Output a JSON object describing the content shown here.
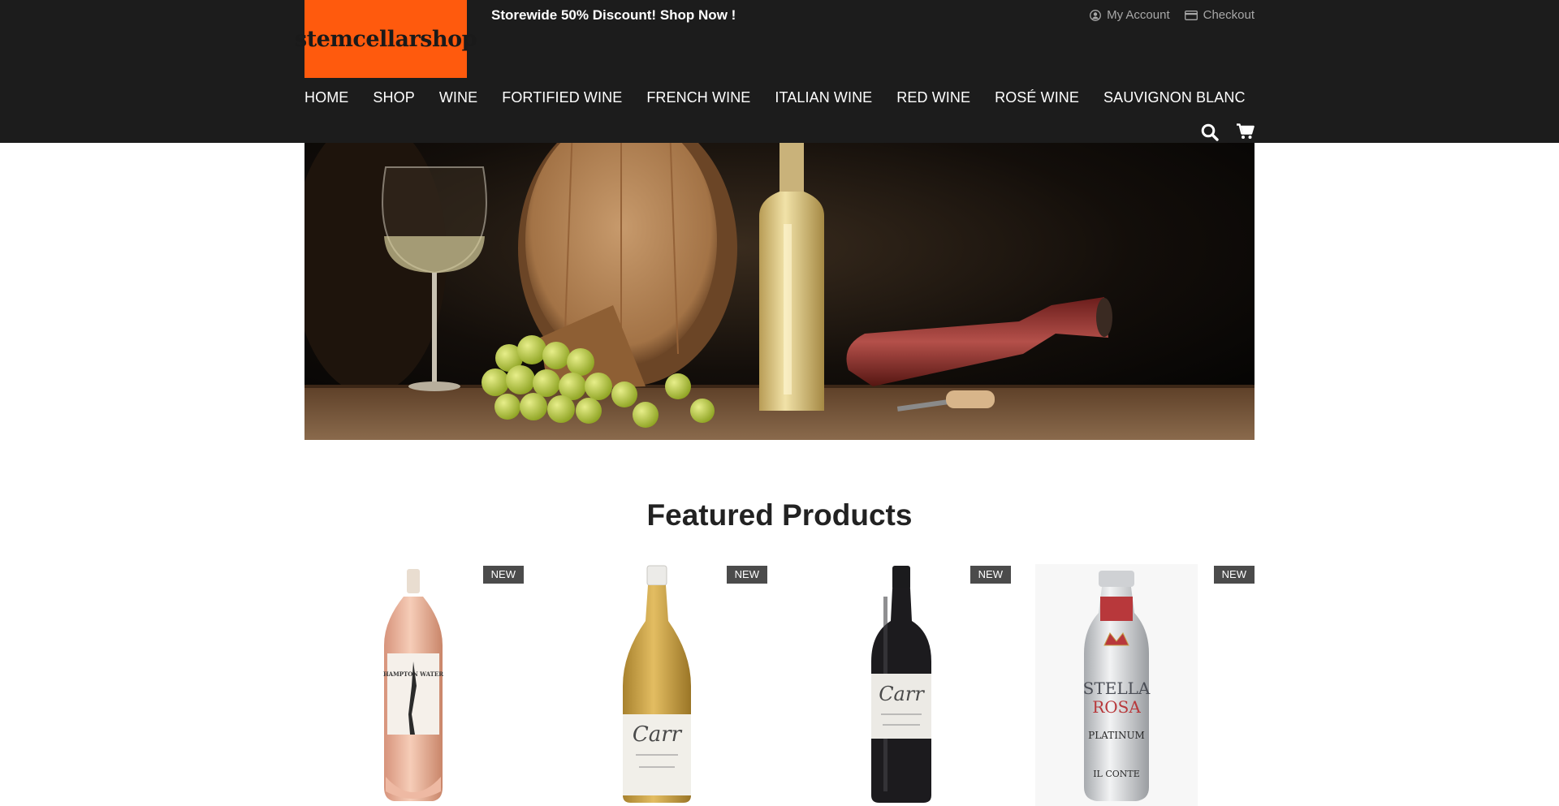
{
  "header": {
    "logo_text": "stemcellarshop",
    "promo": "Storewide 50% Discount! Shop Now !",
    "top_links": {
      "account": "My Account",
      "checkout": "Checkout"
    },
    "nav": [
      "HOME",
      "SHOP",
      "WINE",
      "FORTIFIED WINE",
      "FRENCH WINE",
      "ITALIAN WINE",
      "RED WINE",
      "ROSÉ WINE",
      "SAUVIGNON BLANC"
    ],
    "icons": [
      "search-icon",
      "cart-icon"
    ]
  },
  "featured": {
    "title": "Featured Products",
    "products": [
      {
        "badge": "NEW",
        "label": "Hampton Water rosé bottle"
      },
      {
        "badge": "NEW",
        "label": "Carr white wine bottle"
      },
      {
        "badge": "NEW",
        "label": "Carr red wine bottle"
      },
      {
        "badge": "NEW",
        "label": "Stella Rosa Platinum bottle"
      }
    ]
  },
  "colors": {
    "header_bg": "#1c1c1c",
    "logo_bg": "#ff5a0d",
    "badge_bg": "#4b4b4b"
  }
}
